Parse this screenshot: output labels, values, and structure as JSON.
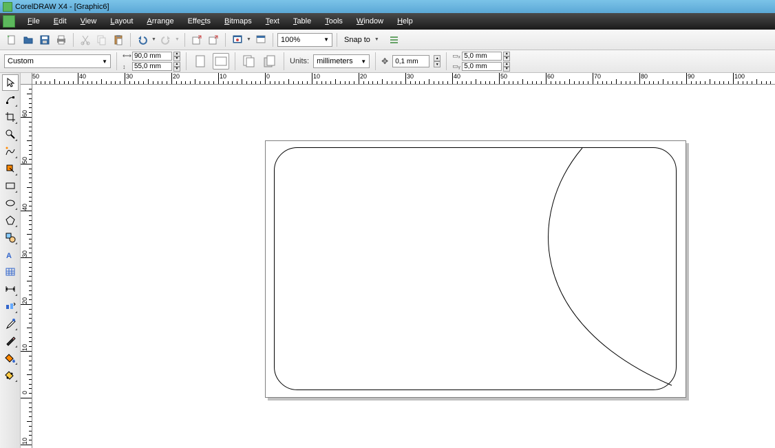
{
  "titlebar": {
    "text": "CorelDRAW X4 - [Graphic6]"
  },
  "menus": [
    {
      "label": "File",
      "u": "F"
    },
    {
      "label": "Edit",
      "u": "E"
    },
    {
      "label": "View",
      "u": "V"
    },
    {
      "label": "Layout",
      "u": "L"
    },
    {
      "label": "Arrange",
      "u": "A"
    },
    {
      "label": "Effects",
      "u": "c"
    },
    {
      "label": "Bitmaps",
      "u": "B"
    },
    {
      "label": "Text",
      "u": "T"
    },
    {
      "label": "Table",
      "u": "T"
    },
    {
      "label": "Tools",
      "u": "T"
    },
    {
      "label": "Window",
      "u": "W"
    },
    {
      "label": "Help",
      "u": "H"
    }
  ],
  "toolbar": {
    "zoom": "100%",
    "snap_label": "Snap to"
  },
  "props": {
    "paper": "Custom",
    "width": "90,0 mm",
    "height": "55,0 mm",
    "units_label": "Units:",
    "units_value": "millimeters",
    "nudge": "0,1 mm",
    "dup_x": "5,0 mm",
    "dup_y": "5,0 mm"
  },
  "ruler_h": [
    -40,
    -30,
    -20,
    -10,
    0,
    10,
    20,
    30,
    40,
    50,
    60,
    70,
    80,
    90,
    100
  ],
  "ruler_v": [
    60,
    50,
    40,
    30,
    20,
    10,
    0
  ]
}
